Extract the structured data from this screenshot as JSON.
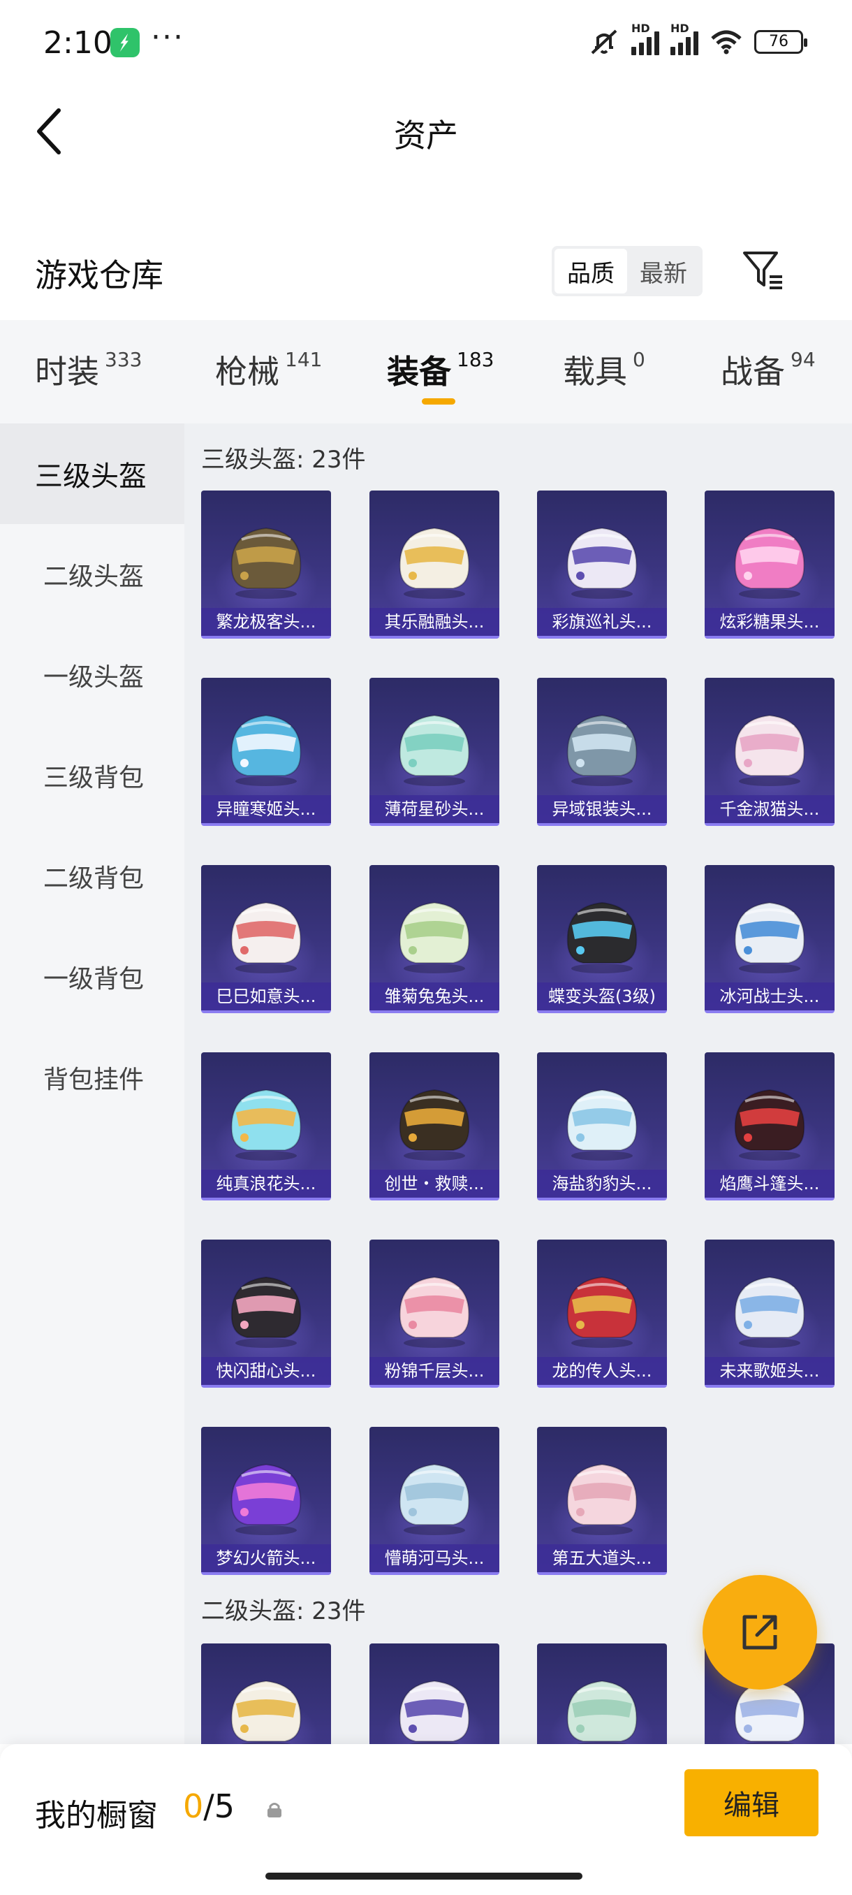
{
  "status_bar": {
    "time": "2:10",
    "dots": "···",
    "network_left": "HD",
    "network_right": "HD",
    "battery": "76"
  },
  "header": {
    "title": "资产",
    "section_title": "游戏仓库",
    "sort_options": [
      "品质",
      "最新"
    ],
    "sort_selected": "品质"
  },
  "tabs": [
    {
      "label": "时装",
      "count": "333"
    },
    {
      "label": "枪械",
      "count": "141"
    },
    {
      "label": "装备",
      "count": "183",
      "active": true
    },
    {
      "label": "载具",
      "count": "0"
    },
    {
      "label": "战备",
      "count": "94"
    }
  ],
  "subnav": [
    "三级头盔",
    "二级头盔",
    "一级头盔",
    "三级背包",
    "二级背包",
    "一级背包",
    "背包挂件"
  ],
  "groups": {
    "g1_title": "三级头盔: 23件",
    "g2_title": "二级头盔: 23件"
  },
  "items_g1": [
    {
      "name": "繁龙极客头...",
      "color": "#6b5a3a",
      "accent": "#c9a24a"
    },
    {
      "name": "其乐融融头...",
      "color": "#f4efe3",
      "accent": "#e7b84a"
    },
    {
      "name": "彩旗巡礼头...",
      "color": "#ece8f5",
      "accent": "#5e4fb0"
    },
    {
      "name": "炫彩糖果头...",
      "color": "#f07dc4",
      "accent": "#ffd2ee"
    },
    {
      "name": "异瞳寒姬头...",
      "color": "#56b6e0",
      "accent": "#f2f7ff"
    },
    {
      "name": "薄荷星砂头...",
      "color": "#bfe9e0",
      "accent": "#7ccfc0"
    },
    {
      "name": "异域银装头...",
      "color": "#7f97a8",
      "accent": "#cfe3f0"
    },
    {
      "name": "千金淑猫头...",
      "color": "#f5e4ec",
      "accent": "#e8a6c6"
    },
    {
      "name": "巳巳如意头...",
      "color": "#f5efee",
      "accent": "#e06a6a"
    },
    {
      "name": "雏菊兔兔头...",
      "color": "#e3f0d4",
      "accent": "#a9cf8c"
    },
    {
      "name": "蝶变头盔(3级)",
      "color": "#2b2b2e",
      "accent": "#58c9f0"
    },
    {
      "name": "冰河战士头...",
      "color": "#e9eef5",
      "accent": "#4a8fd8"
    },
    {
      "name": "纯真浪花头...",
      "color": "#8fe0ee",
      "accent": "#f2b84a"
    },
    {
      "name": "创世・救赎...",
      "color": "#3a2f22",
      "accent": "#e6a93a"
    },
    {
      "name": "海盐豹豹头...",
      "color": "#dff0f8",
      "accent": "#8cc6e6"
    },
    {
      "name": "焰鹰斗篷头...",
      "color": "#3a1d22",
      "accent": "#e24040"
    },
    {
      "name": "快闪甜心头...",
      "color": "#2e2a30",
      "accent": "#f3a6c0"
    },
    {
      "name": "粉锦千层头...",
      "color": "#f7d4dc",
      "accent": "#e98aa2"
    },
    {
      "name": "龙的传人头...",
      "color": "#c8323a",
      "accent": "#e6b84a"
    },
    {
      "name": "未来歌姬头...",
      "color": "#e6ebf5",
      "accent": "#7fb0e6"
    },
    {
      "name": "梦幻火箭头...",
      "color": "#7a3fd6",
      "accent": "#f07ad8"
    },
    {
      "name": "懵萌河马头...",
      "color": "#cfe5f2",
      "accent": "#9fc4dc"
    },
    {
      "name": "第五大道头...",
      "color": "#f5d6de",
      "accent": "#e6a8b8"
    }
  ],
  "items_g2": [
    {
      "name": "",
      "color": "#f4efe3",
      "accent": "#e7b84a"
    },
    {
      "name": "",
      "color": "#ece8f5",
      "accent": "#5e4fb0"
    },
    {
      "name": "",
      "color": "#cfe8dc",
      "accent": "#9ccfb8"
    },
    {
      "name": "",
      "color": "#eef2fa",
      "accent": "#9fb4e6"
    }
  ],
  "bottom": {
    "label": "我的橱窗",
    "current": "0",
    "total": "/5",
    "edit": "编辑"
  }
}
